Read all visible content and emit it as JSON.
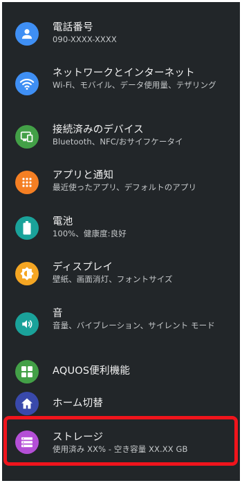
{
  "settings": {
    "items": [
      {
        "title": "電話番号",
        "summary": "090-XXXX-XXXX",
        "icon": "person-icon",
        "color": "#3f8ff4"
      },
      {
        "title": "ネットワークとインターネット",
        "summary": "Wi-Fi、モバイル、データ使用量、テザリング",
        "icon": "wifi-icon",
        "color": "#3f8ff4"
      },
      {
        "title": "接続済みのデバイス",
        "summary": "Bluetooth、NFC/おサイフケータイ",
        "icon": "devices-icon",
        "color": "#43a047"
      },
      {
        "title": "アプリと通知",
        "summary": "最近使ったアプリ、デフォルトのアプリ",
        "icon": "apps-grid-icon",
        "color": "#f57f23"
      },
      {
        "title": "電池",
        "summary": "100%、健康度:良好",
        "icon": "battery-icon",
        "color": "#1aa29a"
      },
      {
        "title": "ディスプレイ",
        "summary": "壁紙、画面消灯、フォントサイズ",
        "icon": "brightness-icon",
        "color": "#f5a623"
      },
      {
        "title": "音",
        "summary": "音量、バイブレーション、サイレント モード",
        "icon": "volume-icon",
        "color": "#1aa29a"
      },
      {
        "title": "AQUOS便利機能",
        "summary": "",
        "icon": "aquos-tiles-icon",
        "color": "#43a047"
      },
      {
        "title": "ホーム切替",
        "summary": "",
        "icon": "home-icon",
        "color": "#3949ab"
      },
      {
        "title": "ストレージ",
        "summary": "使用済み XX% - 空き容量 XX.XX GB",
        "icon": "storage-icon",
        "color": "#b44fd6"
      }
    ]
  },
  "highlight_color": "#f0141c"
}
